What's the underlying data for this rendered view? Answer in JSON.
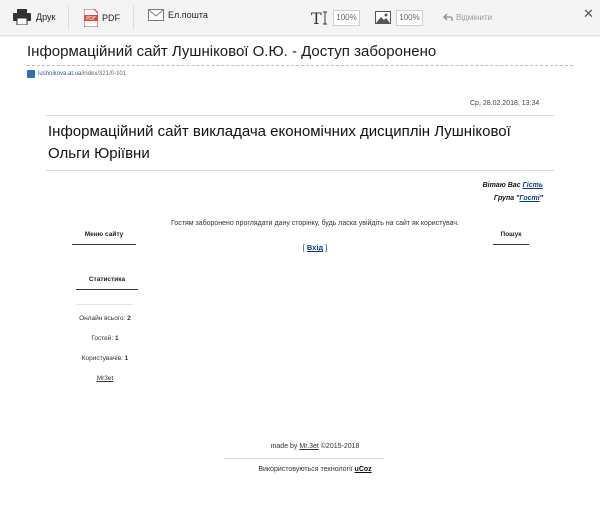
{
  "toolbar": {
    "print": "Друк",
    "pdf": "PDF",
    "email": "Ел.пошта",
    "text_zoom": "100%",
    "image_zoom": "100%",
    "undo": "Відмінити"
  },
  "doc": {
    "title": "Інформаційний сайт Лушнікової О.Ю. - Доступ заборонено",
    "source_domain": "lushnikova.at.ua",
    "source_path": "/index/321/0-101"
  },
  "page": {
    "date": "Ср, 28.02.2018, 13:34",
    "site_title": "Інформаційний сайт викладача економічних дисциплін Лушнікової Ольги Юріївни",
    "greeting_prefix": "Вітаю Вас ",
    "guest_name": "Гість",
    "group_prefix": "Група \"",
    "group_name": "Гості",
    "group_suffix": "\"",
    "menu_title": "Меню сайту",
    "stats_title": "Статистика",
    "search_title": "Пошук",
    "notice": "Гостям заборонено проглядати дану сторінку, будь ласка увійдіть на сайт як користувач.",
    "login_open": "[ ",
    "login_label": "Вхід",
    "login_close": " ]",
    "online_label": "Онлайн всього: ",
    "online_value": "2",
    "guests_label": "Гостей: ",
    "guests_value": "1",
    "users_label": "Користувачів: ",
    "users_value": "1",
    "user_link": "Mr3et"
  },
  "footer": {
    "made_by": "made by ",
    "author": "Mr.3et",
    "copyright": " ©2015-2018",
    "tech_prefix": "Використовуються технології ",
    "tech": "uCoz"
  },
  "icons": {
    "print": "printer-icon",
    "pdf": "pdf-icon",
    "email": "envelope-icon",
    "text_size": "text-size-icon",
    "image": "image-icon",
    "undo": "undo-arrow-icon",
    "close": "close-icon"
  }
}
